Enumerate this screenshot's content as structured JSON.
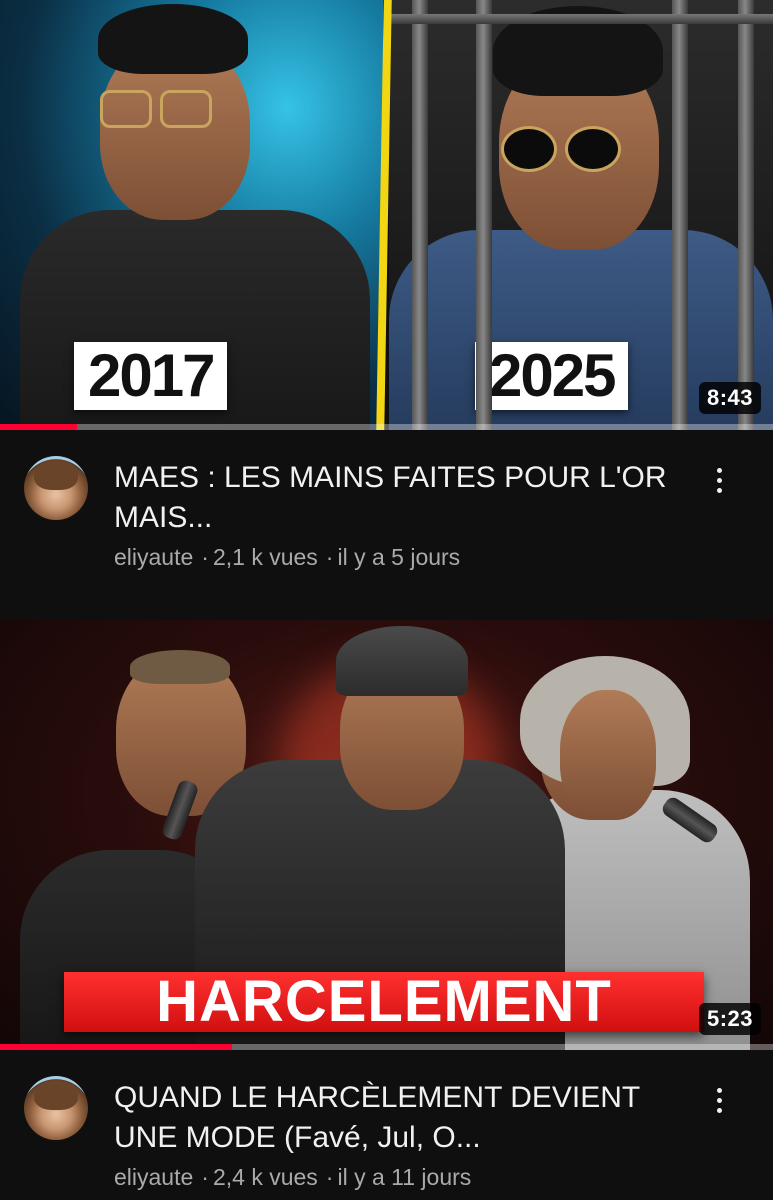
{
  "videos": [
    {
      "year_left": "2017",
      "year_right": "2025",
      "duration": "8:43",
      "progress": 0.1,
      "title": "MAES : LES MAINS FAITES POUR L'OR MAIS...",
      "channel": "eliyaute",
      "views": "2,1 k vues",
      "age": "il y a 5 jours",
      "menu_icon": "kebab-menu-icon"
    },
    {
      "banner": "HARCELEMENT",
      "duration": "5:23",
      "progress": 0.3,
      "title": "QUAND LE HARCÈLEMENT DEVIENT UNE MODE (Favé, Jul, O...",
      "channel": "eliyaute",
      "views": "2,4 k vues",
      "age": "il y a 11 jours",
      "menu_icon": "kebab-menu-icon"
    }
  ],
  "colors": {
    "background": "#0f0f0f",
    "progress": "#ff0033",
    "divider": "#f3d613",
    "banner": "#e01818",
    "secondary_text": "#aaaaaa"
  }
}
